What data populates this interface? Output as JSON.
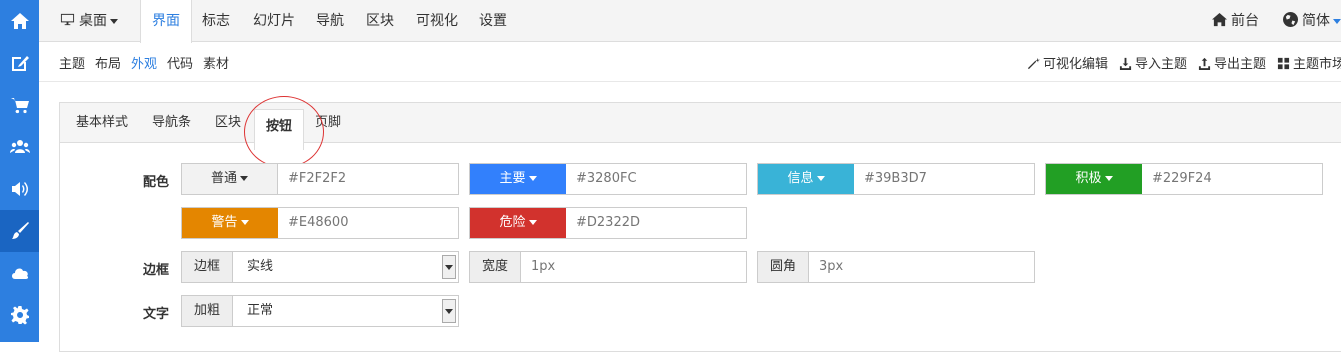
{
  "sidebar": {
    "items": [
      {
        "icon": "home-icon"
      },
      {
        "icon": "edit-icon"
      },
      {
        "icon": "cart-icon"
      },
      {
        "icon": "users-icon"
      },
      {
        "icon": "volume-icon"
      },
      {
        "icon": "brush-icon"
      },
      {
        "icon": "cloud-icon"
      },
      {
        "icon": "gear-icon"
      }
    ],
    "active_index": 5
  },
  "topnav": {
    "desktop_label": "桌面",
    "items": [
      "界面",
      "标志",
      "幻灯片",
      "导航",
      "区块",
      "可视化",
      "设置"
    ],
    "frontend_label": "前台",
    "language_label": "简体"
  },
  "subnav": {
    "items": [
      "主题",
      "布局",
      "外观",
      "代码",
      "素材"
    ],
    "actions": [
      "可视化编辑",
      "导入主题",
      "导出主题",
      "主题市场"
    ]
  },
  "tabs": [
    "基本样式",
    "导航条",
    "区块",
    "按钮",
    "页脚"
  ],
  "form": {
    "color_label": "配色",
    "colors": [
      {
        "name": "普通",
        "value": "#F2F2F2",
        "bg": "#f2f2f2",
        "fg": "#333333"
      },
      {
        "name": "主要",
        "value": "#3280FC",
        "bg": "#3280fc",
        "fg": "#ffffff"
      },
      {
        "name": "信息",
        "value": "#39B3D7",
        "bg": "#39b3d7",
        "fg": "#ffffff"
      },
      {
        "name": "积极",
        "value": "#229F24",
        "bg": "#229f24",
        "fg": "#ffffff"
      },
      {
        "name": "警告",
        "value": "#E48600",
        "bg": "#e48600",
        "fg": "#ffffff"
      },
      {
        "name": "危险",
        "value": "#D2322D",
        "bg": "#d2322d",
        "fg": "#ffffff"
      }
    ],
    "border_label": "边框",
    "border_addon": "边框",
    "border_style": "实线",
    "width_addon": "宽度",
    "width_placeholder": "1px",
    "radius_addon": "圆角",
    "radius_placeholder": "3px",
    "text_label": "文字",
    "text_addon": "加粗",
    "text_weight": "正常"
  }
}
